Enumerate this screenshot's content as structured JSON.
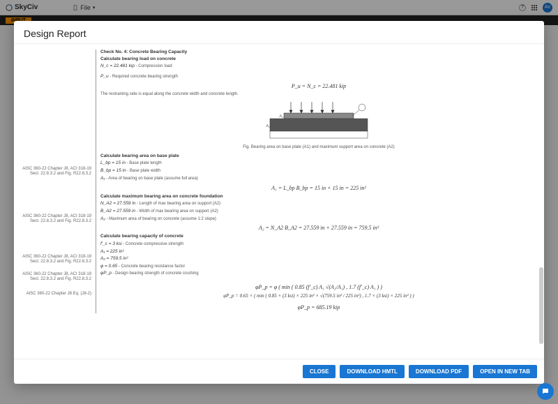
{
  "app": {
    "name": "SkyCiv",
    "file_label": "File",
    "avatar": "AV"
  },
  "secondbar": {
    "input_tab": "INPUT"
  },
  "modal": {
    "title": "Design Report",
    "buttons": {
      "close": "CLOSE",
      "download_html": "DOWNLOAD HMTL",
      "download_pdf": "DOWNLOAD PDF",
      "open_new_tab": "OPEN IN NEW TAB"
    }
  },
  "report": {
    "refs": {
      "r1": "AISC 360-22 Chapter J8, ACI 318-19 Sect. 22.8.3.2 and Fig. R22.8.3.2",
      "r2": "AISC 360-22 Chapter J8, ACI 318-19 Sect. 22.8.3.2 and Fig. R22.8.3.2",
      "r3": "AISC 360-22 Chapter J8, ACI 318-19 Sect. 22.8.3.2 and Fig. R22.8.3.2",
      "r4": "AISC 360-22 Chapter J8, ACI 318-19 Sect. 22.8.3.2 and Fig. R22.8.3.2",
      "r5": "AISC 360-22 Chapter J8 Eq. (J8-2)"
    },
    "check_title": "Check No. 4: Concrete Bearing Capacity",
    "sec1_title": "Calculate bearing load on concrete",
    "sec1_l1": "N_c = 22.481 kip",
    "sec1_l1d": " - Compression load",
    "sec1_l2": "P_u",
    "sec1_l2d": " - Required concrete bearing strength",
    "eq1": "P_u = N_c = 22.481 kip",
    "restrain_note": "The restraining side is equal along the concrete width and concrete length.",
    "fig_a1": "A₁",
    "fig_a2": "A₂",
    "figcaption": "Fig. Bearing area on base plate (A1) and maximum support area on concrete (A2)",
    "sec2_title": "Calculate bearing area on base plate",
    "sec2_l1": "L_bp = 15 in",
    "sec2_l1d": " - Base plate length",
    "sec2_l2": "B_bp = 15 in",
    "sec2_l2d": " - Base plate width",
    "sec2_l3": "A₁",
    "sec2_l3d": " - Area of bearing on base plate (assume full area)",
    "eq2": "A₁ = L_bp B_bp = 15 in × 15 in = 225 in²",
    "sec3_title": "Calculate maximum bearing area on concrete foundation",
    "sec3_l1": "N_A2 = 27.559 in",
    "sec3_l1d": " - Length of max bearing area on support (A2)",
    "sec3_l2": "B_A2 = 27.559 in",
    "sec3_l2d": " - Width of max bearing area on support (A2)",
    "sec3_l3": "A₂",
    "sec3_l3d": " - Maximum area of bearing on concrete (assume 1:2 slope)",
    "eq3": "A₂ = N_A2 B_A2 = 27.559 in × 27.559 in = 759.5 in²",
    "sec4_title": "Calculate bearing capacity of concrete",
    "sec4_l1": "f'_c = 3 ksi",
    "sec4_l1d": " - Concrete compressive strength",
    "sec4_l2": "A₁ = 225 in²",
    "sec4_l3": "A₂ = 759.5 in²",
    "sec4_l4": "φ = 0.65",
    "sec4_l4d": " - Concrete bearing resistance factor",
    "sec4_l5": "φP_p",
    "sec4_l5d": " - Design bearing strength of concrete crushing",
    "eq4": "φP_p = φ ( min ( 0.85 (f'_c) A₁ √(A₂/A₁) , 1.7 (f'_c) A₁ ) )",
    "eq5": "φP_p = 0.65 × ( min ( 0.85 × (3 ksi) × 225 in² × √(759.5 in² / 225 in²) , 1.7 × (3 ksi) × 225 in² ) )",
    "eq6": "φP_p = 685.19 kip"
  }
}
